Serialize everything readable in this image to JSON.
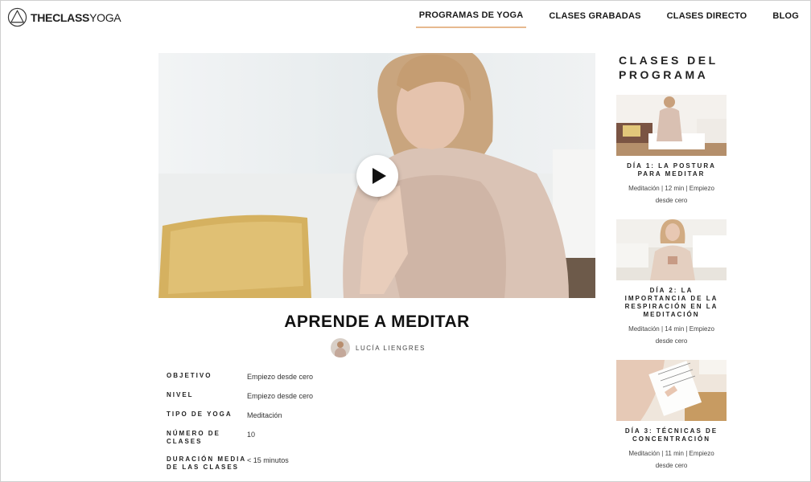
{
  "header": {
    "logo_bold": "THECLASS",
    "logo_light": "YOGA",
    "nav": [
      {
        "label": "PROGRAMAS DE YOGA",
        "active": true
      },
      {
        "label": "CLASES GRABADAS",
        "active": false
      },
      {
        "label": "CLASES DIRECTO",
        "active": false
      },
      {
        "label": "BLOG",
        "active": false
      }
    ]
  },
  "course": {
    "title": "APRENDE A MEDITAR",
    "instructor": "LUCÍA LIENGRES",
    "details": [
      {
        "label": "OBJETIVO",
        "value": "Empiezo desde cero"
      },
      {
        "label": "NIVEL",
        "value": "Empiezo desde cero"
      },
      {
        "label": "TIPO DE YOGA",
        "value": "Meditación"
      },
      {
        "label": "NÚMERO DE CLASES",
        "value": "10"
      },
      {
        "label": "DURACIÓN MEDIA DE LAS CLASES",
        "value": "< 15 minutos"
      }
    ]
  },
  "sidebar": {
    "title": "CLASES DEL PROGRAMA",
    "classes": [
      {
        "title": "DÍA 1: LA POSTURA PARA MEDITAR",
        "meta": "Meditación | 12 min | Empiezo desde cero"
      },
      {
        "title": "DÍA 2: LA IMPORTANCIA DE LA RESPIRACIÓN EN LA MEDITACIÓN",
        "meta": "Meditación | 14 min | Empiezo desde cero"
      },
      {
        "title": "DÍA 3: TÉCNICAS DE CONCENTRACIÓN",
        "meta": "Meditación | 11 min | Empiezo desde cero"
      }
    ]
  },
  "colors": {
    "accent": "#e7b98f"
  }
}
